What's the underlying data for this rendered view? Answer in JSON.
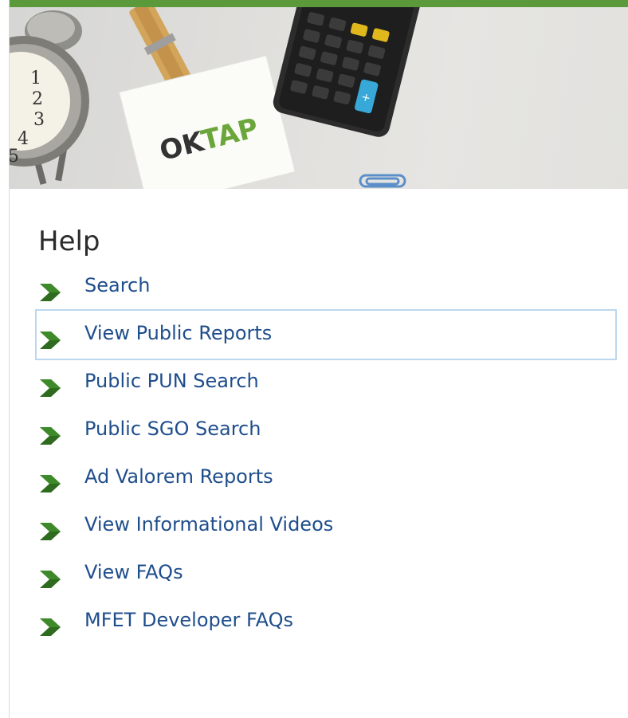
{
  "banner": {
    "brand_logo": "OKTAP",
    "accent_color": "#5a9a3a"
  },
  "help": {
    "title": "Help",
    "items": [
      {
        "label": "Search"
      },
      {
        "label": "View Public Reports",
        "focused": true
      },
      {
        "label": "Public PUN Search"
      },
      {
        "label": "Public SGO Search"
      },
      {
        "label": "Ad Valorem Reports"
      },
      {
        "label": "View Informational Videos"
      },
      {
        "label": "View FAQs"
      },
      {
        "label": "MFET Developer FAQs"
      }
    ],
    "bullet_icon": "chevron-right-icon",
    "link_color": "#1f4e8c"
  }
}
